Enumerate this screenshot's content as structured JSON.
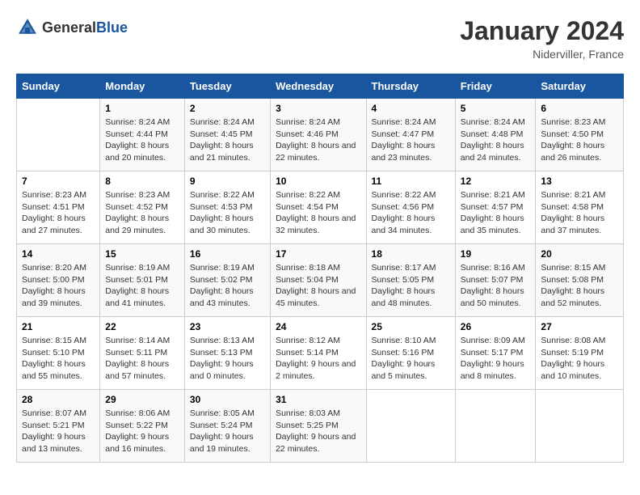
{
  "header": {
    "logo_general": "General",
    "logo_blue": "Blue",
    "month_year": "January 2024",
    "location": "Niderviller, France"
  },
  "days_of_week": [
    "Sunday",
    "Monday",
    "Tuesday",
    "Wednesday",
    "Thursday",
    "Friday",
    "Saturday"
  ],
  "weeks": [
    [
      {
        "day": "",
        "sunrise": "",
        "sunset": "",
        "daylight": ""
      },
      {
        "day": "1",
        "sunrise": "Sunrise: 8:24 AM",
        "sunset": "Sunset: 4:44 PM",
        "daylight": "Daylight: 8 hours and 20 minutes."
      },
      {
        "day": "2",
        "sunrise": "Sunrise: 8:24 AM",
        "sunset": "Sunset: 4:45 PM",
        "daylight": "Daylight: 8 hours and 21 minutes."
      },
      {
        "day": "3",
        "sunrise": "Sunrise: 8:24 AM",
        "sunset": "Sunset: 4:46 PM",
        "daylight": "Daylight: 8 hours and 22 minutes."
      },
      {
        "day": "4",
        "sunrise": "Sunrise: 8:24 AM",
        "sunset": "Sunset: 4:47 PM",
        "daylight": "Daylight: 8 hours and 23 minutes."
      },
      {
        "day": "5",
        "sunrise": "Sunrise: 8:24 AM",
        "sunset": "Sunset: 4:48 PM",
        "daylight": "Daylight: 8 hours and 24 minutes."
      },
      {
        "day": "6",
        "sunrise": "Sunrise: 8:23 AM",
        "sunset": "Sunset: 4:50 PM",
        "daylight": "Daylight: 8 hours and 26 minutes."
      }
    ],
    [
      {
        "day": "7",
        "sunrise": "Sunrise: 8:23 AM",
        "sunset": "Sunset: 4:51 PM",
        "daylight": "Daylight: 8 hours and 27 minutes."
      },
      {
        "day": "8",
        "sunrise": "Sunrise: 8:23 AM",
        "sunset": "Sunset: 4:52 PM",
        "daylight": "Daylight: 8 hours and 29 minutes."
      },
      {
        "day": "9",
        "sunrise": "Sunrise: 8:22 AM",
        "sunset": "Sunset: 4:53 PM",
        "daylight": "Daylight: 8 hours and 30 minutes."
      },
      {
        "day": "10",
        "sunrise": "Sunrise: 8:22 AM",
        "sunset": "Sunset: 4:54 PM",
        "daylight": "Daylight: 8 hours and 32 minutes."
      },
      {
        "day": "11",
        "sunrise": "Sunrise: 8:22 AM",
        "sunset": "Sunset: 4:56 PM",
        "daylight": "Daylight: 8 hours and 34 minutes."
      },
      {
        "day": "12",
        "sunrise": "Sunrise: 8:21 AM",
        "sunset": "Sunset: 4:57 PM",
        "daylight": "Daylight: 8 hours and 35 minutes."
      },
      {
        "day": "13",
        "sunrise": "Sunrise: 8:21 AM",
        "sunset": "Sunset: 4:58 PM",
        "daylight": "Daylight: 8 hours and 37 minutes."
      }
    ],
    [
      {
        "day": "14",
        "sunrise": "Sunrise: 8:20 AM",
        "sunset": "Sunset: 5:00 PM",
        "daylight": "Daylight: 8 hours and 39 minutes."
      },
      {
        "day": "15",
        "sunrise": "Sunrise: 8:19 AM",
        "sunset": "Sunset: 5:01 PM",
        "daylight": "Daylight: 8 hours and 41 minutes."
      },
      {
        "day": "16",
        "sunrise": "Sunrise: 8:19 AM",
        "sunset": "Sunset: 5:02 PM",
        "daylight": "Daylight: 8 hours and 43 minutes."
      },
      {
        "day": "17",
        "sunrise": "Sunrise: 8:18 AM",
        "sunset": "Sunset: 5:04 PM",
        "daylight": "Daylight: 8 hours and 45 minutes."
      },
      {
        "day": "18",
        "sunrise": "Sunrise: 8:17 AM",
        "sunset": "Sunset: 5:05 PM",
        "daylight": "Daylight: 8 hours and 48 minutes."
      },
      {
        "day": "19",
        "sunrise": "Sunrise: 8:16 AM",
        "sunset": "Sunset: 5:07 PM",
        "daylight": "Daylight: 8 hours and 50 minutes."
      },
      {
        "day": "20",
        "sunrise": "Sunrise: 8:15 AM",
        "sunset": "Sunset: 5:08 PM",
        "daylight": "Daylight: 8 hours and 52 minutes."
      }
    ],
    [
      {
        "day": "21",
        "sunrise": "Sunrise: 8:15 AM",
        "sunset": "Sunset: 5:10 PM",
        "daylight": "Daylight: 8 hours and 55 minutes."
      },
      {
        "day": "22",
        "sunrise": "Sunrise: 8:14 AM",
        "sunset": "Sunset: 5:11 PM",
        "daylight": "Daylight: 8 hours and 57 minutes."
      },
      {
        "day": "23",
        "sunrise": "Sunrise: 8:13 AM",
        "sunset": "Sunset: 5:13 PM",
        "daylight": "Daylight: 9 hours and 0 minutes."
      },
      {
        "day": "24",
        "sunrise": "Sunrise: 8:12 AM",
        "sunset": "Sunset: 5:14 PM",
        "daylight": "Daylight: 9 hours and 2 minutes."
      },
      {
        "day": "25",
        "sunrise": "Sunrise: 8:10 AM",
        "sunset": "Sunset: 5:16 PM",
        "daylight": "Daylight: 9 hours and 5 minutes."
      },
      {
        "day": "26",
        "sunrise": "Sunrise: 8:09 AM",
        "sunset": "Sunset: 5:17 PM",
        "daylight": "Daylight: 9 hours and 8 minutes."
      },
      {
        "day": "27",
        "sunrise": "Sunrise: 8:08 AM",
        "sunset": "Sunset: 5:19 PM",
        "daylight": "Daylight: 9 hours and 10 minutes."
      }
    ],
    [
      {
        "day": "28",
        "sunrise": "Sunrise: 8:07 AM",
        "sunset": "Sunset: 5:21 PM",
        "daylight": "Daylight: 9 hours and 13 minutes."
      },
      {
        "day": "29",
        "sunrise": "Sunrise: 8:06 AM",
        "sunset": "Sunset: 5:22 PM",
        "daylight": "Daylight: 9 hours and 16 minutes."
      },
      {
        "day": "30",
        "sunrise": "Sunrise: 8:05 AM",
        "sunset": "Sunset: 5:24 PM",
        "daylight": "Daylight: 9 hours and 19 minutes."
      },
      {
        "day": "31",
        "sunrise": "Sunrise: 8:03 AM",
        "sunset": "Sunset: 5:25 PM",
        "daylight": "Daylight: 9 hours and 22 minutes."
      },
      {
        "day": "",
        "sunrise": "",
        "sunset": "",
        "daylight": ""
      },
      {
        "day": "",
        "sunrise": "",
        "sunset": "",
        "daylight": ""
      },
      {
        "day": "",
        "sunrise": "",
        "sunset": "",
        "daylight": ""
      }
    ]
  ]
}
